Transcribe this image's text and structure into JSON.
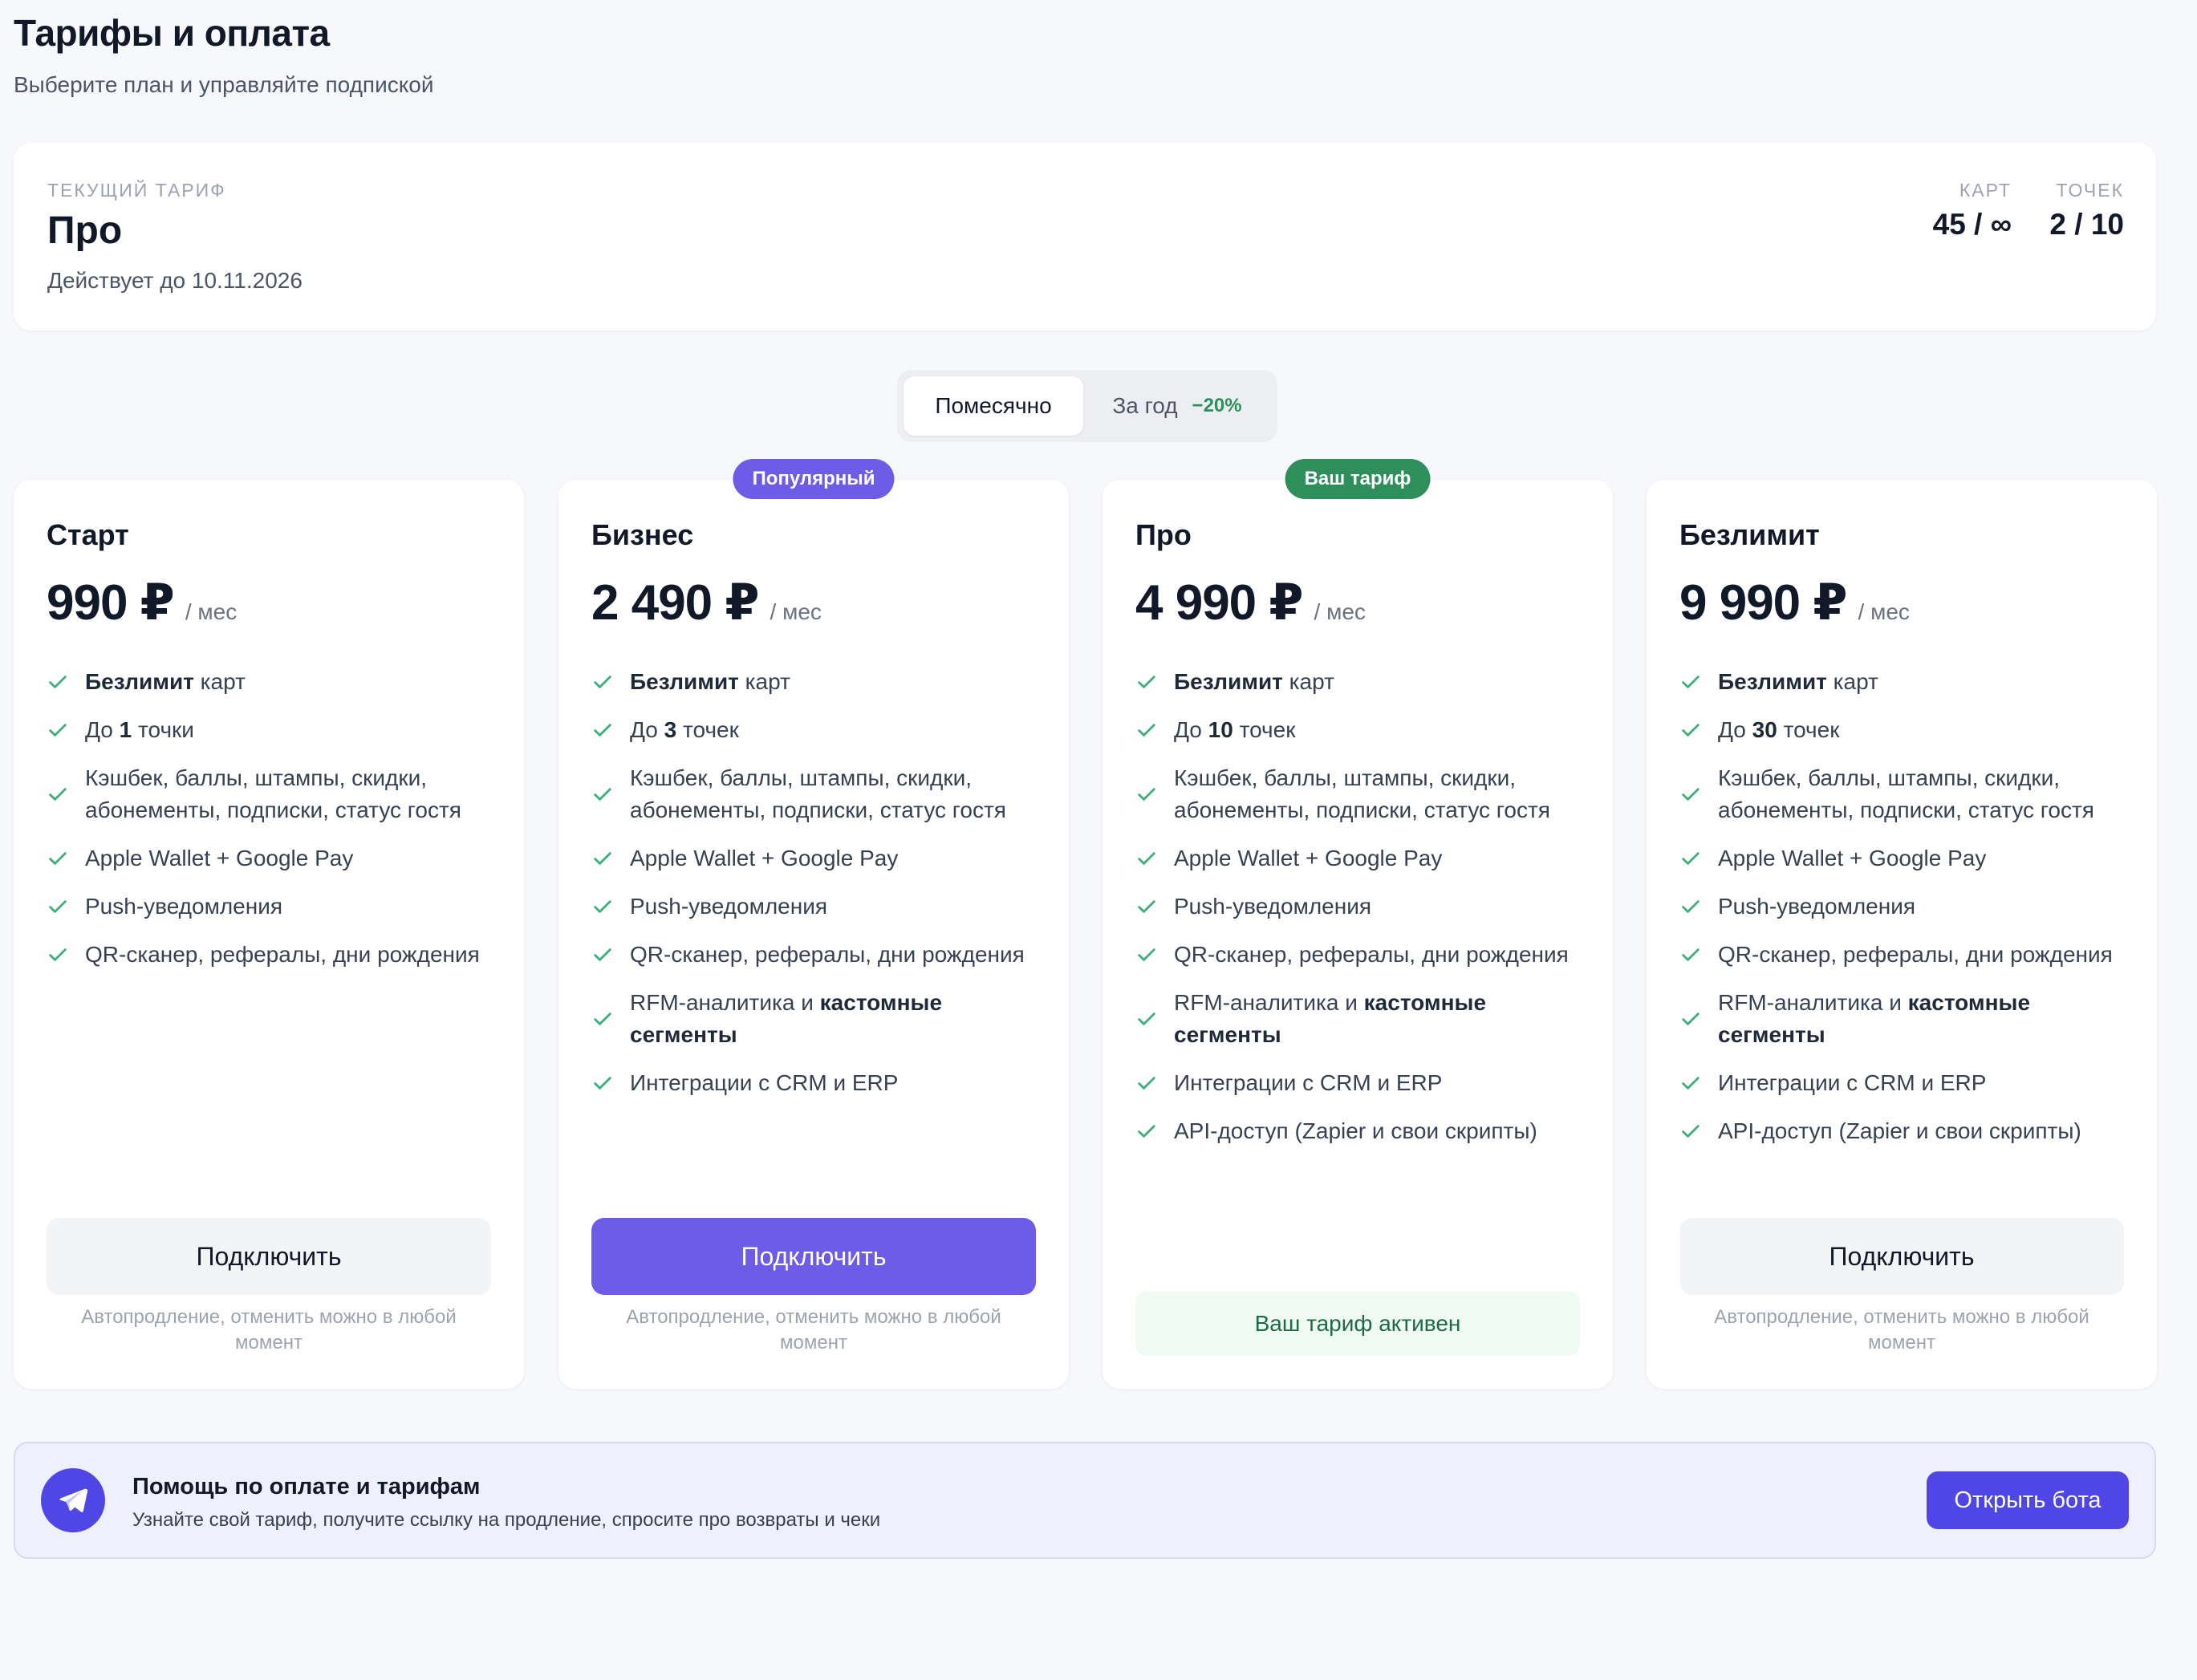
{
  "header": {
    "title": "Тарифы и оплата",
    "subtitle": "Выберите план и управляйте подпиской"
  },
  "current_plan": {
    "label": "ТЕКУЩИЙ ТАРИФ",
    "name": "Про",
    "valid_until": "Действует до 10.11.2026",
    "stats": [
      {
        "label": "КАРТ",
        "value": "45 / ∞"
      },
      {
        "label": "ТОЧЕК",
        "value": "2 / 10"
      }
    ]
  },
  "billing_toggle": {
    "monthly": "Помесячно",
    "yearly": "За год",
    "yearly_discount": "−20%",
    "selected": "monthly"
  },
  "plans": [
    {
      "name": "Старт",
      "price": "990 ₽",
      "period": "/ мес",
      "badge": "",
      "features": [
        {
          "bold": "Безлимит",
          "text": " карт"
        },
        {
          "pre": "До ",
          "bold": "1",
          "text": " точки"
        },
        {
          "text": "Кэшбек, баллы, штампы, скидки, абонементы, подписки, статус гостя"
        },
        {
          "text": "Apple Wallet + Google Pay"
        },
        {
          "text": "Push-уведомления"
        },
        {
          "text": "QR-сканер, рефералы, дни рождения"
        }
      ],
      "button": "Подключить",
      "note": "Автопродление, отменить можно в любой момент"
    },
    {
      "name": "Бизнес",
      "price": "2 490 ₽",
      "period": "/ мес",
      "badge": "Популярный",
      "features": [
        {
          "bold": "Безлимит",
          "text": " карт"
        },
        {
          "pre": "До ",
          "bold": "3",
          "text": " точек"
        },
        {
          "text": "Кэшбек, баллы, штампы, скидки, абонементы, подписки, статус гостя"
        },
        {
          "text": "Apple Wallet + Google Pay"
        },
        {
          "text": "Push-уведомления"
        },
        {
          "text": "QR-сканер, рефералы, дни рождения"
        },
        {
          "pre": "RFM-аналитика и ",
          "bold": "кастомные сегменты",
          "text": ""
        },
        {
          "text": "Интеграции с CRM и ERP"
        }
      ],
      "button": "Подключить",
      "note": "Автопродление, отменить можно в любой момент"
    },
    {
      "name": "Про",
      "price": "4 990 ₽",
      "period": "/ мес",
      "badge": "Ваш тариф",
      "features": [
        {
          "bold": "Безлимит",
          "text": " карт"
        },
        {
          "pre": "До ",
          "bold": "10",
          "text": " точек"
        },
        {
          "text": "Кэшбек, баллы, штампы, скидки, абонементы, подписки, статус гостя"
        },
        {
          "text": "Apple Wallet + Google Pay"
        },
        {
          "text": "Push-уведомления"
        },
        {
          "text": "QR-сканер, рефералы, дни рождения"
        },
        {
          "pre": "RFM-аналитика и ",
          "bold": "кастомные сегменты",
          "text": ""
        },
        {
          "text": "Интеграции с CRM и ERP"
        },
        {
          "text": "API-доступ (Zapier и свои скрипты)"
        }
      ],
      "active_label": "Ваш тариф активен"
    },
    {
      "name": "Безлимит",
      "price": "9 990 ₽",
      "period": "/ мес",
      "badge": "",
      "features": [
        {
          "bold": "Безлимит",
          "text": " карт"
        },
        {
          "pre": "До ",
          "bold": "30",
          "text": " точек"
        },
        {
          "text": "Кэшбек, баллы, штампы, скидки, абонементы, подписки, статус гостя"
        },
        {
          "text": "Apple Wallet + Google Pay"
        },
        {
          "text": "Push-уведомления"
        },
        {
          "text": "QR-сканер, рефералы, дни рождения"
        },
        {
          "pre": "RFM-аналитика и ",
          "bold": "кастомные сегменты",
          "text": ""
        },
        {
          "text": "Интеграции с CRM и ERP"
        },
        {
          "text": "API-доступ (Zapier и свои скрипты)"
        }
      ],
      "button": "Подключить",
      "note": "Автопродление, отменить можно в любой момент"
    }
  ],
  "help": {
    "title": "Помощь по оплате и тарифам",
    "text": "Узнайте свой тариф, получите ссылку на продление, спросите про возвраты и чеки",
    "button": "Открыть бота",
    "icon": "telegram-send-icon"
  },
  "colors": {
    "accent": "#6c5ce7",
    "help_accent": "#4f46e5",
    "success": "#2f8f5b",
    "check": "#3fae78"
  }
}
